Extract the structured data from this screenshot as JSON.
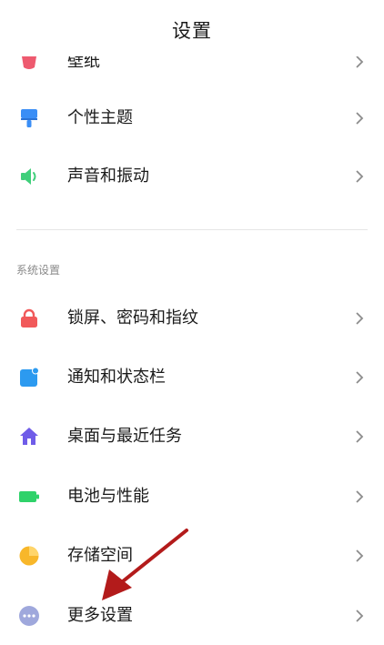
{
  "header": {
    "title": "设置"
  },
  "top_items": [
    {
      "label": "壁纸",
      "icon": "wallpaper-icon",
      "icon_color": "#ee5a6f"
    },
    {
      "label": "个性主题",
      "icon": "theme-brush-icon",
      "icon_color": "#3a8ef6"
    },
    {
      "label": "声音和振动",
      "icon": "speaker-icon",
      "icon_color": "#3fcf7a"
    }
  ],
  "section": {
    "title": "系统设置"
  },
  "system_items": [
    {
      "label": "锁屏、密码和指纹",
      "icon": "lock-icon",
      "icon_color": "#f1595a"
    },
    {
      "label": "通知和状态栏",
      "icon": "notification-icon",
      "icon_color": "#2c9af0"
    },
    {
      "label": "桌面与最近任务",
      "icon": "home-icon",
      "icon_color": "#6f5ce8"
    },
    {
      "label": "电池与性能",
      "icon": "battery-icon",
      "icon_color": "#2fd26a"
    },
    {
      "label": "存储空间",
      "icon": "storage-pie-icon",
      "icon_color": "#f8b72a"
    },
    {
      "label": "更多设置",
      "icon": "more-dots-icon",
      "icon_color": "#9fa8dc"
    }
  ],
  "annotation": {
    "arrow_color": "#b31b1b"
  }
}
